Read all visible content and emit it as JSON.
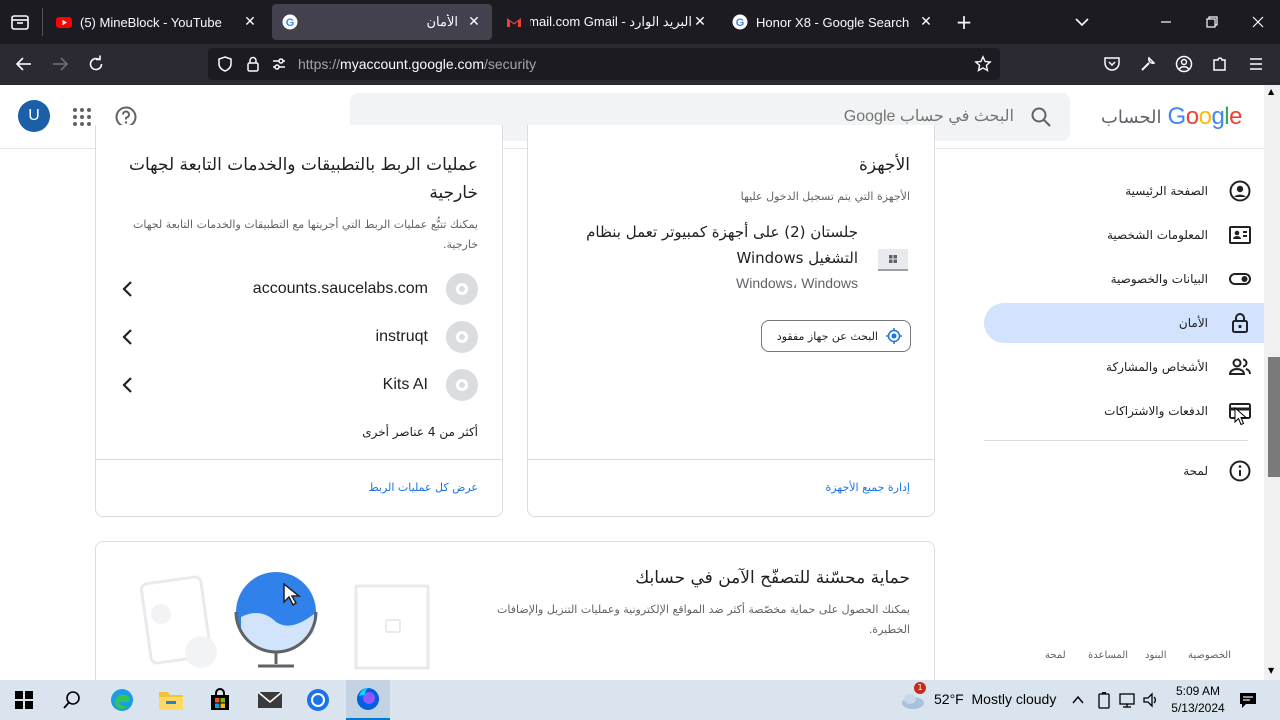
{
  "browser": {
    "tabs": [
      {
        "title": "(5) MineBlock - YouTube",
        "favicon": "youtube-icon",
        "active": false
      },
      {
        "title": "الأمان",
        "favicon": "google-icon",
        "active": true
      },
      {
        "title": "البريد الوارد - Gmail ‏gmail.com",
        "favicon": "gmail-icon",
        "active": false
      },
      {
        "title": "Honor X8 - Google Search",
        "favicon": "google-icon",
        "active": false
      }
    ],
    "url": {
      "prefix": "https://",
      "host": "myaccount.google.com",
      "path": "/security"
    }
  },
  "header": {
    "logo_word": "Google",
    "logo_suffix": "الحساب",
    "search_placeholder": "البحث في حساب Google",
    "avatar_letter": "U"
  },
  "sidebar": {
    "items": [
      {
        "label": "الصفحة الرئيسية",
        "icon": "account-circle-icon"
      },
      {
        "label": "المعلومات الشخصية",
        "icon": "id-card-icon"
      },
      {
        "label": "البيانات والخصوصية",
        "icon": "toggle-icon"
      },
      {
        "label": "الأمان",
        "icon": "lock-icon",
        "active": true
      },
      {
        "label": "الأشخاص والمشاركة",
        "icon": "people-icon"
      },
      {
        "label": "الدفعات والاشتراكات",
        "icon": "credit-card-icon"
      },
      {
        "label": "لمحة",
        "icon": "info-icon"
      }
    ]
  },
  "devices_card": {
    "title": "الأجهزة",
    "desc": "الأجهزة التي يتم تسجيل الدخول عليها",
    "device_title": "جلستان (2) على أجهزة كمبيوتر تعمل بنظام التشغيل Windows",
    "device_sub": "Windows، Windows",
    "find_button": "البحث عن جهاز مفقود",
    "manage_link": "إدارة جميع الأجهزة"
  },
  "apps_card": {
    "title": "عمليات الربط بالتطبيقات والخدمات التابعة لجهات خارجية",
    "desc": "يمكنك تتبُّع عمليات الربط التي أجريتها مع التطبيقات والخدمات التابعة لجهات خارجية.",
    "apps": [
      "accounts.saucelabs.com",
      "instruqt",
      "Kits AI"
    ],
    "more": "أكثر من 4 عناصر أخرى",
    "view_all": "عرض كل عمليات الربط"
  },
  "safe_browsing": {
    "title": "حماية محسّنة للتصفّح الآمن في حسابك",
    "desc": "يمكنك الحصول على حماية مخصّصة أكثر ضد المواقع الإلكترونية وعمليات التنزيل والإضافات الخطيرة."
  },
  "footer": {
    "links": [
      "الخصوصية",
      "البنود",
      "المساعدة",
      "لمحة"
    ]
  },
  "taskbar": {
    "weather_temp": "52°F",
    "weather_text": "Mostly cloudy",
    "time": "5:09 AM",
    "date": "5/13/2024",
    "weather_badge": "1"
  }
}
